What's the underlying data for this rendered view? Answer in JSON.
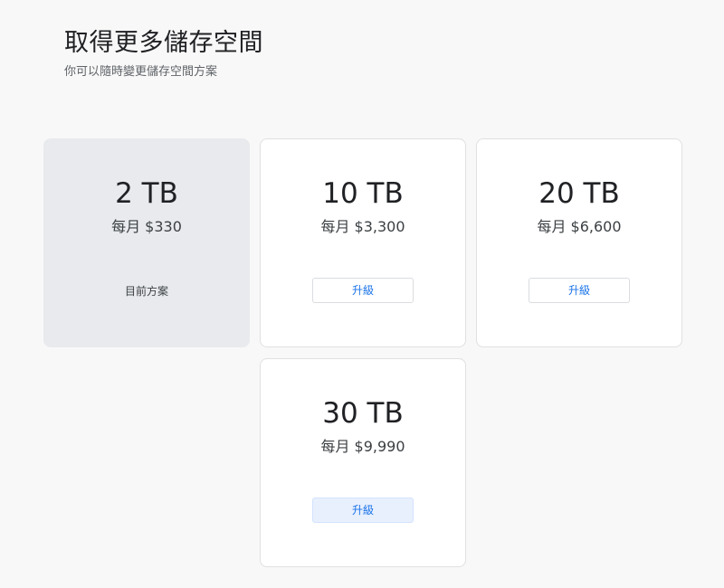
{
  "header": {
    "title": "取得更多儲存空間",
    "subtitle": "你可以隨時變更儲存空間方案"
  },
  "plans": [
    {
      "size": "2 TB",
      "price": "每月 $330",
      "status": "目前方案",
      "current": true
    },
    {
      "size": "10 TB",
      "price": "每月 $3,300",
      "action": "升級",
      "current": false
    },
    {
      "size": "20 TB",
      "price": "每月 $6,600",
      "action": "升級",
      "current": false
    },
    {
      "size": "30 TB",
      "price": "每月 $9,990",
      "action": "升級",
      "current": false,
      "hovered": true
    }
  ],
  "colors": {
    "background": "#f8f8f8",
    "current_card": "#e8eaed",
    "accent": "#1a73e8",
    "hover_button": "#e8f0fe"
  }
}
